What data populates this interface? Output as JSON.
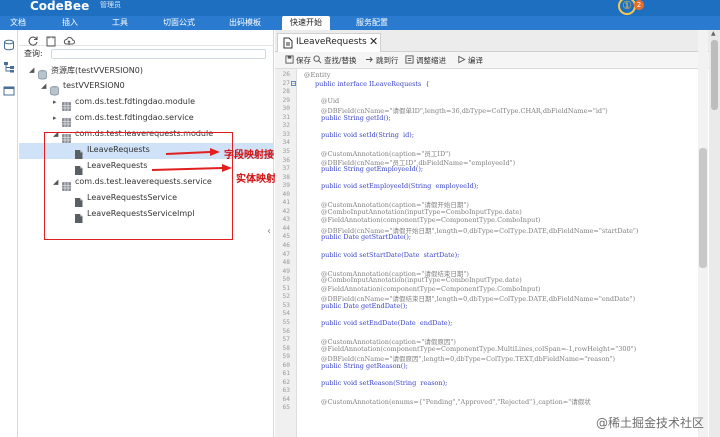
{
  "app": {
    "brand": "CodeBee",
    "user": "管理员"
  },
  "header": {
    "notification_icon": "info-circle-icon",
    "badge": "2",
    "badge_color": "#e86c2c"
  },
  "menu": {
    "items": [
      "文档",
      "插入",
      "工具",
      "切面公式",
      "出码模板",
      "快速开始",
      "服务配置"
    ],
    "active": "快速开始"
  },
  "left_panel": {
    "search_label": "查询:",
    "tree": [
      {
        "label": "资源库(testVVERSION0)",
        "icon": "database-icon"
      },
      {
        "label": "testVVERSION0",
        "icon": "database-icon"
      },
      {
        "label": "com.ds.test.fdtingdao.module",
        "icon": "package-icon"
      },
      {
        "label": "com.ds.test.fdtingdao.service",
        "icon": "package-icon"
      },
      {
        "label": "com.ds.test.leaverequests.module",
        "icon": "package-icon"
      },
      {
        "label": "ILeaveRequests",
        "icon": "file-icon"
      },
      {
        "label": "LeaveRequests",
        "icon": "file-icon"
      },
      {
        "label": "com.ds.test.leaverequests.service",
        "icon": "package-icon"
      },
      {
        "label": "LeaveRequestsService",
        "icon": "file-icon"
      },
      {
        "label": "LeaveRequestsServiceImpl",
        "icon": "file-icon"
      }
    ],
    "annotations": [
      "字段映射接口",
      "实体映射"
    ]
  },
  "editor": {
    "tab_label": "ILeaveRequests",
    "toolbar": [
      "保存",
      "查找/替换",
      "跳到行",
      "调整缩进",
      "编译"
    ],
    "lines": [
      {
        "n": "26",
        "code": "@Entity"
      },
      {
        "n": "27",
        "code": "public interface ILeaveRequests  {"
      },
      {
        "n": "28",
        "code": ""
      },
      {
        "n": "29",
        "code": "@Uid"
      },
      {
        "n": "30",
        "code": "@DBField(cnName=\"请假单ID\",length=36,dbType=ColType.CHAR,dbFieldName=\"id\")"
      },
      {
        "n": "31",
        "code": "public String getId();"
      },
      {
        "n": "32",
        "code": ""
      },
      {
        "n": "33",
        "code": "public void setId(String  id);"
      },
      {
        "n": "34",
        "code": ""
      },
      {
        "n": "35",
        "code": "@CustomAnnotation(caption=\"员工ID\")"
      },
      {
        "n": "36",
        "code": "@DBField(cnName=\"员工ID\",dbFieldName=\"employeeId\")"
      },
      {
        "n": "37",
        "code": "public String getEmployeeId();"
      },
      {
        "n": "38",
        "code": ""
      },
      {
        "n": "39",
        "code": "public void setEmployeeId(String  employeeId);"
      },
      {
        "n": "40",
        "code": ""
      },
      {
        "n": "41",
        "code": "@CustomAnnotation(caption=\"请假开始日期\")"
      },
      {
        "n": "42",
        "code": "@ComboInputAnnotation(inputType=ComboInputType.date)"
      },
      {
        "n": "43",
        "code": "@FieldAnnotation(componentType=ComponentType.ComboInput)"
      },
      {
        "n": "44",
        "code": "@DBField(cnName=\"请假开始日期\",length=0,dbType=ColType.DATE,dbFieldName=\"startDate\")"
      },
      {
        "n": "45",
        "code": "public Date getStartDate();"
      },
      {
        "n": "46",
        "code": ""
      },
      {
        "n": "47",
        "code": "public void setStartDate(Date  startDate);"
      },
      {
        "n": "48",
        "code": ""
      },
      {
        "n": "49",
        "code": "@CustomAnnotation(caption=\"请假结束日期\")"
      },
      {
        "n": "50",
        "code": "@ComboInputAnnotation(inputType=ComboInputType.date)"
      },
      {
        "n": "51",
        "code": "@FieldAnnotation(componentType=ComponentType.ComboInput)"
      },
      {
        "n": "52",
        "code": "@DBField(cnName=\"请假结束日期\",length=0,dbType=ColType.DATE,dbFieldName=\"endDate\")"
      },
      {
        "n": "53",
        "code": "public Date getEndDate();"
      },
      {
        "n": "54",
        "code": ""
      },
      {
        "n": "55",
        "code": "public void setEndDate(Date  endDate);"
      },
      {
        "n": "56",
        "code": ""
      },
      {
        "n": "57",
        "code": "@CustomAnnotation(caption=\"请假原因\")"
      },
      {
        "n": "58",
        "code": "@FieldAnnotation(componentType=ComponentType.MultiLines,colSpan=-1,rowHeight=\"300\")"
      },
      {
        "n": "59",
        "code": "@DBField(cnName=\"请假原因\",length=0,dbType=ColType.TEXT,dbFieldName=\"reason\")"
      },
      {
        "n": "60",
        "code": "public String getReason();"
      },
      {
        "n": "61",
        "code": ""
      },
      {
        "n": "62",
        "code": "public void setReason(String  reason);"
      },
      {
        "n": "63",
        "code": ""
      },
      {
        "n": "64",
        "code": "@CustomAnnotation(enums={\"Pending\",\"Approved\",\"Rejected\"},caption=\"请假状"
      },
      {
        "n": "65",
        "code": ""
      }
    ]
  },
  "watermark": "@稀土掘金技术社区"
}
